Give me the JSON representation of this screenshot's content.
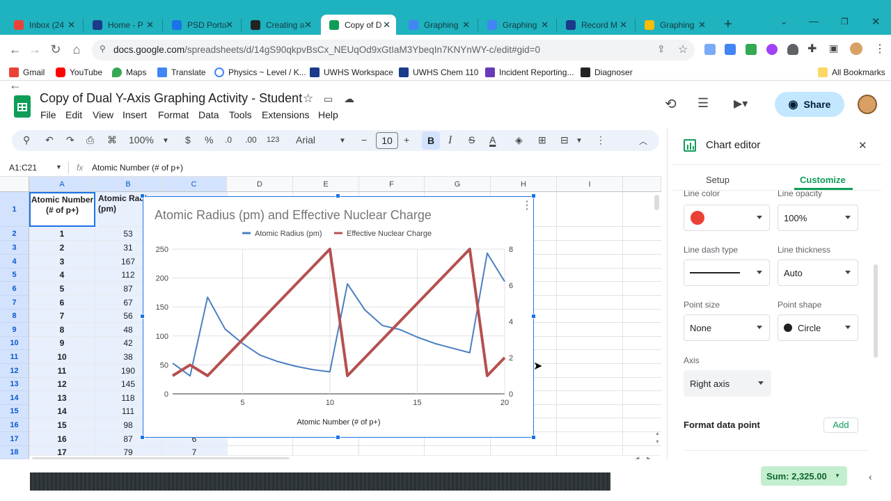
{
  "tabs": [
    {
      "title": "Inbox (24",
      "icon": "gmail-icon",
      "color": "#ea4335"
    },
    {
      "title": "Home - P",
      "icon": "p-icon",
      "color": "#1a3a8a"
    },
    {
      "title": "PSD Porta",
      "icon": "portal-icon",
      "color": "#1a73e8"
    },
    {
      "title": "Creating a",
      "icon": "s-icon",
      "color": "#222"
    },
    {
      "title": "Copy of D",
      "icon": "sheets-icon",
      "color": "#0f9d58"
    },
    {
      "title": "Graphing",
      "icon": "docs-icon",
      "color": "#4285f4"
    },
    {
      "title": "Graphing",
      "icon": "docs-icon",
      "color": "#4285f4"
    },
    {
      "title": "Record M",
      "icon": "sis-icon",
      "color": "#1a3a8a"
    },
    {
      "title": "Graphing",
      "icon": "drive-icon",
      "color": "#fbbc04"
    }
  ],
  "address": {
    "host": "docs.google.com",
    "path": "/spreadsheets/d/14gS90qkpvBsCx_NEUqOd9xGtIaM3YbeqIn7KNYnWY-c/edit#gid=0"
  },
  "bookmarks": [
    "Gmail",
    "YouTube",
    "Maps",
    "Translate",
    "Physics ~ Level / K...",
    "UWHS Workspace",
    "UWHS Chem 110",
    "Incident Reporting...",
    "Diagnoser"
  ],
  "all_bookmarks": "All Bookmarks",
  "doc": {
    "title": "Copy of Dual Y-Axis Graphing Activity - Student",
    "menus": [
      "File",
      "Edit",
      "View",
      "Insert",
      "Format",
      "Data",
      "Tools",
      "Extensions",
      "Help"
    ],
    "share": "Share"
  },
  "toolbar": {
    "zoom": "100%",
    "currency": "$",
    "percent": "%",
    "dec_dec": ".0",
    "inc_dec": ".00",
    "num_fmt": "123",
    "font": "Arial",
    "font_size": "10",
    "bold": "B",
    "italic": "I",
    "strike": "S",
    "text_color": "A"
  },
  "formula": {
    "name_box": "A1:C21",
    "fx": "fx",
    "content": "Atomic Number (# of p+)"
  },
  "grid": {
    "columns": [
      "A",
      "B",
      "C",
      "D",
      "E",
      "F",
      "G",
      "H",
      "I"
    ],
    "rows": [
      "1",
      "2",
      "3",
      "4",
      "5",
      "6",
      "7",
      "8",
      "9",
      "10",
      "11",
      "12",
      "13",
      "14",
      "15",
      "16",
      "17",
      "18"
    ],
    "header_a": "Atomic Number (# of p+)",
    "header_b": "Atomic Radius (pm)",
    "col_a": [
      "1",
      "2",
      "3",
      "4",
      "5",
      "6",
      "7",
      "8",
      "9",
      "10",
      "11",
      "12",
      "13",
      "14",
      "15",
      "16",
      "17"
    ],
    "col_b": [
      "53",
      "31",
      "167",
      "112",
      "87",
      "67",
      "56",
      "48",
      "42",
      "38",
      "190",
      "145",
      "118",
      "111",
      "98",
      "87",
      "79"
    ],
    "col_c_visible": {
      "16": "6",
      "17": "7"
    }
  },
  "chart_data": {
    "type": "line",
    "title": "Atomic Radius (pm) and Effective Nuclear Charge",
    "xlabel": "Atomic Number (# of p+)",
    "x": [
      1,
      2,
      3,
      4,
      5,
      6,
      7,
      8,
      9,
      10,
      11,
      12,
      13,
      14,
      15,
      16,
      17,
      18,
      19,
      20
    ],
    "xticks": [
      "5",
      "10",
      "15",
      "20"
    ],
    "xlim": [
      1,
      20
    ],
    "y_left_ticks": [
      "0",
      "50",
      "100",
      "150",
      "200",
      "250"
    ],
    "y_left_lim": [
      0,
      250
    ],
    "y_right_ticks": [
      "0",
      "2",
      "4",
      "6",
      "8"
    ],
    "y_right_lim": [
      0,
      8
    ],
    "legend_position": "top",
    "grid": true,
    "series": [
      {
        "name": "Atomic Radius (pm)",
        "axis": "left",
        "color": "#4a7fc1",
        "values": [
          53,
          31,
          167,
          112,
          87,
          67,
          56,
          48,
          42,
          38,
          190,
          145,
          118,
          111,
          98,
          87,
          79,
          71,
          243,
          194
        ]
      },
      {
        "name": "Effective Nuclear Charge",
        "axis": "right",
        "color": "#b5504f",
        "values": [
          1,
          1.6,
          1,
          2,
          3,
          4,
          5,
          6,
          7,
          8,
          1,
          2,
          3,
          4,
          5,
          6,
          7,
          8,
          1,
          2
        ]
      }
    ]
  },
  "editor": {
    "title": "Chart editor",
    "tabs": {
      "setup": "Setup",
      "customize": "Customize"
    },
    "line_color_label": "Line color",
    "line_color": "#e94235",
    "line_opacity_label": "Line opacity",
    "line_opacity": "100%",
    "dash_label": "Line dash type",
    "thickness_label": "Line thickness",
    "thickness": "Auto",
    "point_size_label": "Point size",
    "point_size": "None",
    "point_shape_label": "Point shape",
    "point_shape": "Circle",
    "axis_label": "Axis",
    "axis": "Right axis",
    "format_point": "Format data point",
    "add": "Add"
  },
  "status": {
    "sum": "Sum: 2,325.00"
  }
}
